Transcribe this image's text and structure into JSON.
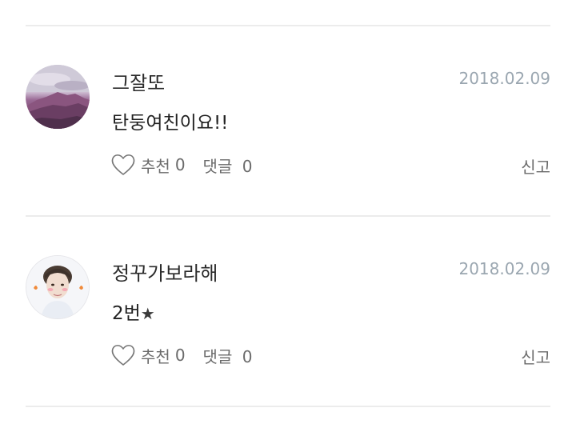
{
  "comments": [
    {
      "username": "그잘또",
      "date": "2018.02.09",
      "text": "탄둥여친이요!!",
      "like_label": "추천",
      "like_count": "0",
      "reply_label": "댓글",
      "reply_count": "0",
      "report_label": "신고",
      "avatar_icon": "mountain-landscape"
    },
    {
      "username": "정꾸가보라해",
      "date": "2018.02.09",
      "text": "2번",
      "text_suffix": "★",
      "like_label": "추천",
      "like_count": "0",
      "reply_label": "댓글",
      "reply_count": "0",
      "report_label": "신고",
      "avatar_icon": "person-portrait"
    }
  ]
}
